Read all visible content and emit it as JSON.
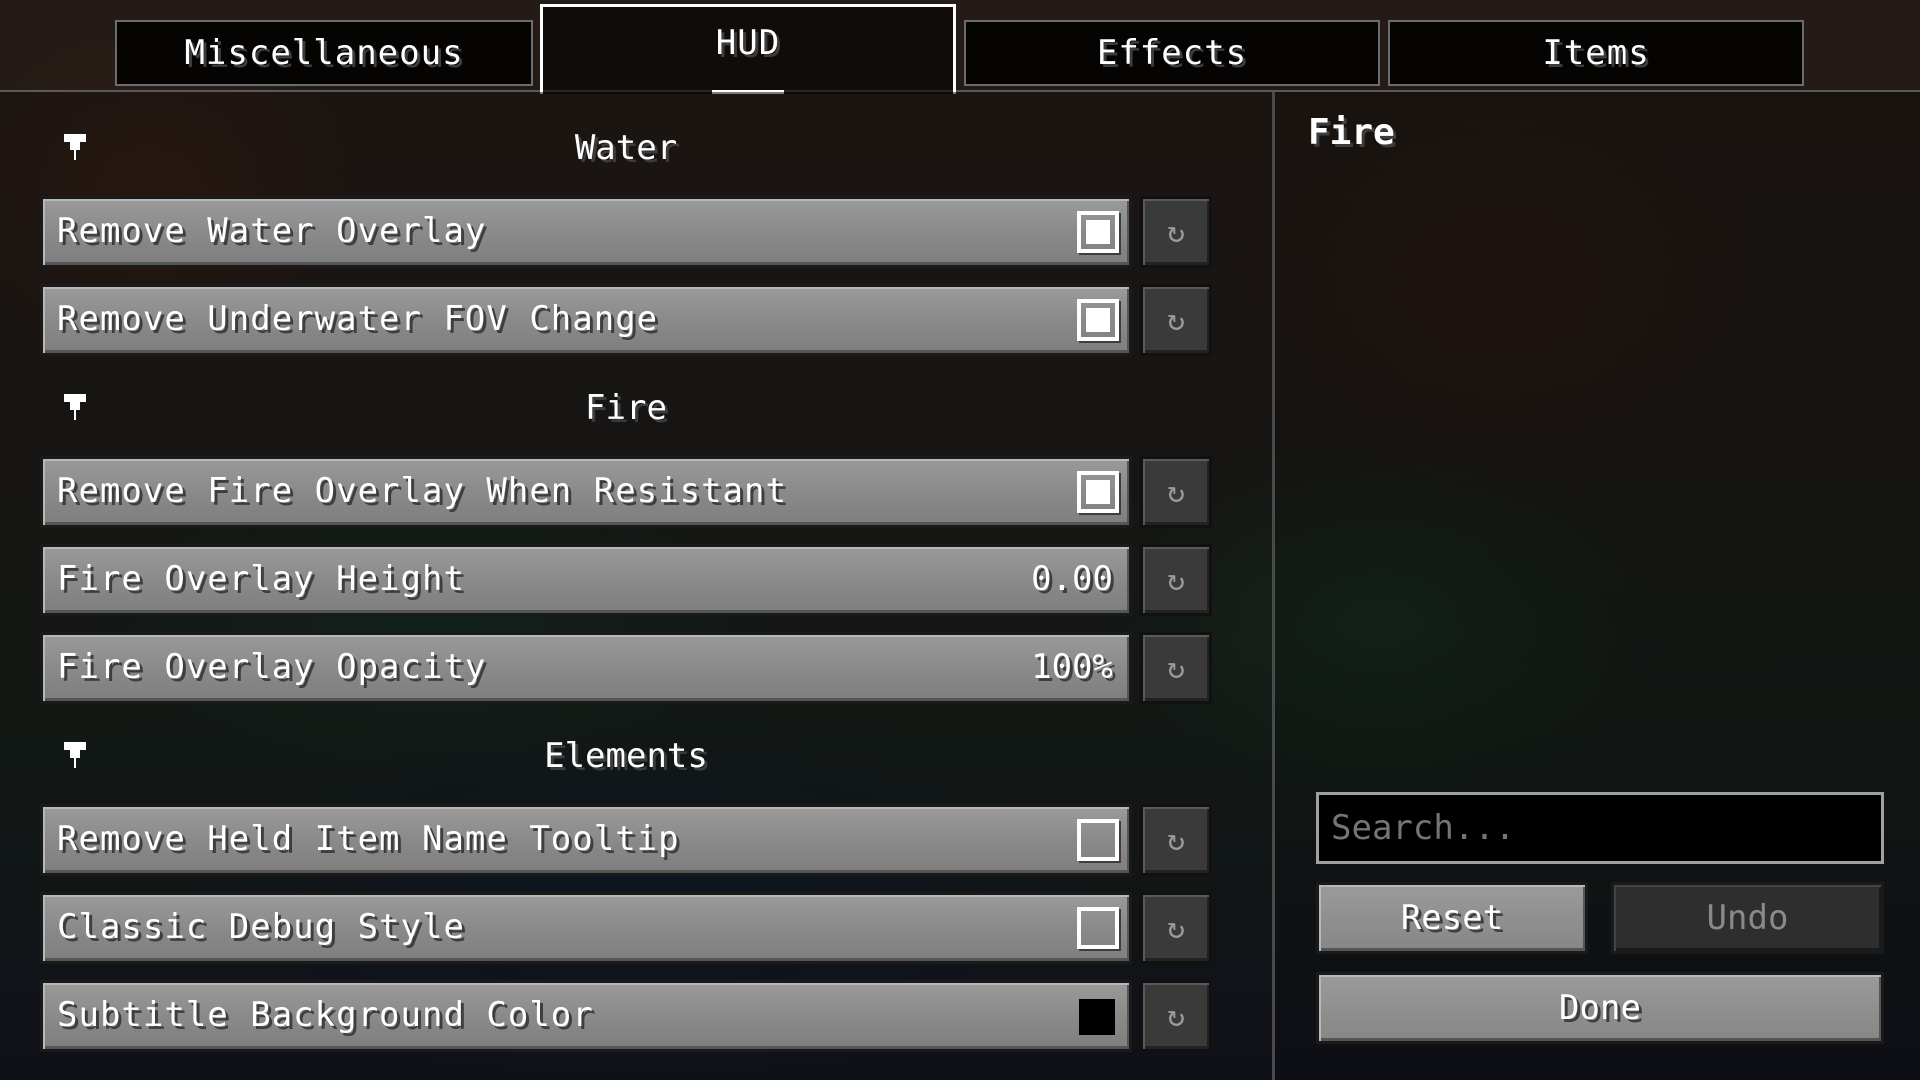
{
  "tabs": [
    {
      "label": "Miscellaneous",
      "active": false
    },
    {
      "label": "HUD",
      "active": true
    },
    {
      "label": "Effects",
      "active": false
    },
    {
      "label": "Items",
      "active": false
    }
  ],
  "sections": [
    {
      "title": "Water",
      "rows": [
        {
          "label": "Remove Water Overlay",
          "type": "checkbox",
          "checked": true
        },
        {
          "label": "Remove Underwater FOV Change",
          "type": "checkbox",
          "checked": true
        }
      ]
    },
    {
      "title": "Fire",
      "rows": [
        {
          "label": "Remove Fire Overlay When Resistant",
          "type": "checkbox",
          "checked": true
        },
        {
          "label": "Fire Overlay Height",
          "type": "value",
          "value": "0.00"
        },
        {
          "label": "Fire Overlay Opacity",
          "type": "value",
          "value": "100%"
        }
      ]
    },
    {
      "title": "Elements",
      "rows": [
        {
          "label": "Remove Held Item Name Tooltip",
          "type": "checkbox",
          "checked": false
        },
        {
          "label": "Classic Debug Style",
          "type": "checkbox",
          "checked": false
        },
        {
          "label": "Subtitle Background Color",
          "type": "color",
          "color": "#000000"
        }
      ]
    }
  ],
  "reset_icon": "reset-arrow-icon",
  "info_panel": {
    "title": "Fire"
  },
  "search": {
    "placeholder": "Search..."
  },
  "buttons": {
    "reset": "Reset",
    "undo": "Undo",
    "done": "Done"
  }
}
